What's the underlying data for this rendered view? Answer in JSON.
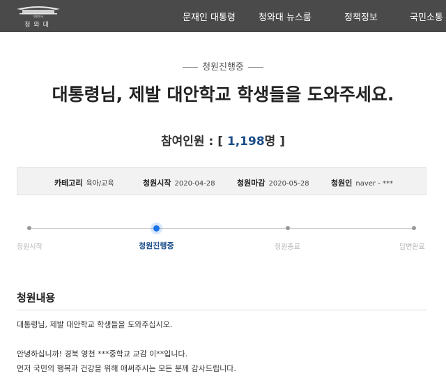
{
  "header": {
    "logo": {
      "subtitle": "대한민국",
      "name": "청와대",
      "icon": "cheongwadae-building-logo"
    },
    "nav": [
      "문재인 대통령",
      "청와대 뉴스룸",
      "정책정보",
      "국민소통"
    ]
  },
  "petition": {
    "status": "청원진행중",
    "title": "대통령님, 제발 대안학교 학생들을 도와주세요.",
    "participants_label": "참여인원 :",
    "bracket_open": "[",
    "count": "1,198",
    "unit": "명",
    "bracket_close": "]",
    "info": [
      {
        "key": "카테고리",
        "value": "육아/교육"
      },
      {
        "key": "청원시작",
        "value": "2020-04-28"
      },
      {
        "key": "청원마감",
        "value": "2020-05-28"
      },
      {
        "key": "청원인",
        "value": "naver - ***"
      }
    ],
    "progress": {
      "current_step": 1,
      "steps": [
        "청원시작",
        "청원진행중",
        "청원종료",
        "답변완료"
      ]
    }
  },
  "content": {
    "section_title": "청원내용",
    "lines": [
      "대통령님, 제발 대안학교 학생들을 도와주십시오.",
      "안녕하십니까! 경북 영천 ***중학교 교감 이**입니다.",
      "먼저 국민의 행복과 건강을 위해 애써주시는 모든 분께 감사드립니다."
    ]
  },
  "colors": {
    "topbar": "#4a4a4a",
    "accent": "#1d4e89",
    "active_dot": "#1a73e8"
  }
}
